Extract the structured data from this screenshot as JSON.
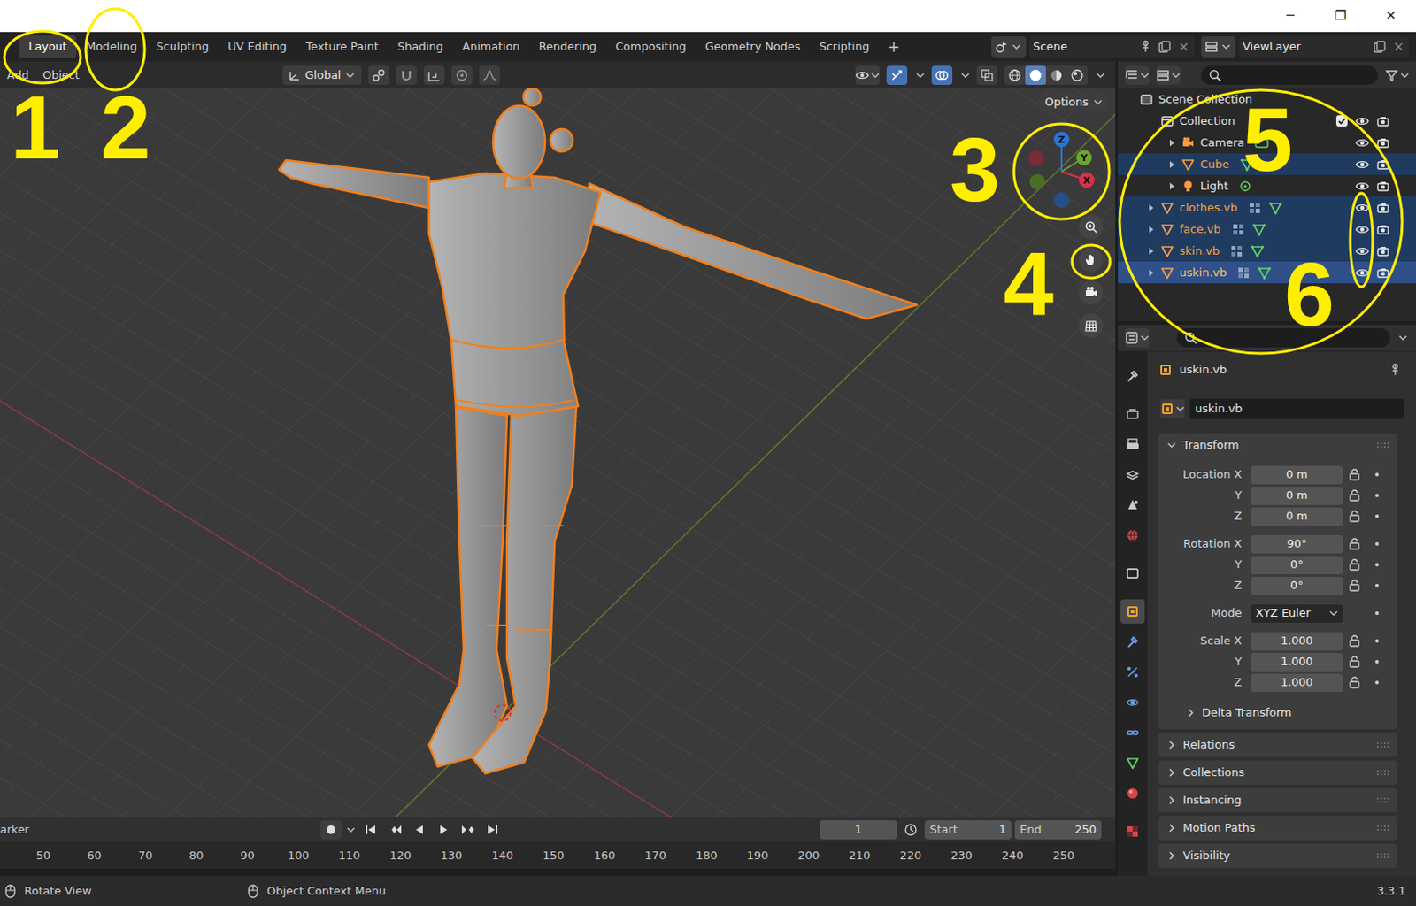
{
  "window": {
    "controls": [
      "─",
      "❐",
      "✕"
    ]
  },
  "workspaces": [
    {
      "label": "Layout",
      "selected": true
    },
    {
      "label": "Modeling",
      "selected": false
    },
    {
      "label": "Sculpting",
      "selected": false
    },
    {
      "label": "UV Editing",
      "selected": false
    },
    {
      "label": "Texture Paint",
      "selected": false
    },
    {
      "label": "Shading",
      "selected": false
    },
    {
      "label": "Animation",
      "selected": false
    },
    {
      "label": "Rendering",
      "selected": false
    },
    {
      "label": "Compositing",
      "selected": false
    },
    {
      "label": "Geometry Nodes",
      "selected": false
    },
    {
      "label": "Scripting",
      "selected": false
    }
  ],
  "add_workspace": "+",
  "scene": {
    "label": "Scene"
  },
  "view_layer": {
    "label": "ViewLayer"
  },
  "viewport": {
    "menus": [
      "Add",
      "Object"
    ],
    "orientation": "Global",
    "options": "Options",
    "gizmo_axes": [
      "X",
      "Y",
      "Z"
    ],
    "toggles": [
      {
        "kind": "gizmo",
        "on": true
      },
      {
        "kind": "overlay",
        "on": true
      },
      {
        "kind": "xray",
        "on": false
      }
    ],
    "shading": [
      {
        "mode": "wireframe",
        "selected": false
      },
      {
        "mode": "solid",
        "selected": true
      },
      {
        "mode": "material",
        "selected": false
      },
      {
        "mode": "rendered",
        "selected": false
      }
    ]
  },
  "annotations": [
    {
      "label": "1"
    },
    {
      "label": "2"
    },
    {
      "label": "3"
    },
    {
      "label": "4"
    },
    {
      "label": "5"
    },
    {
      "label": "6"
    }
  ],
  "outliner": {
    "items": [
      {
        "label": "Scene Collection",
        "kind": "scene",
        "depth": 0,
        "selected": false,
        "active": false
      },
      {
        "label": "Collection",
        "kind": "collection",
        "depth": 1,
        "selected": false,
        "active": false,
        "checked": true,
        "visible": true,
        "renderable": true
      },
      {
        "label": "Camera",
        "kind": "camera",
        "depth": 2,
        "expanded": false,
        "selected": false,
        "active": false,
        "modifiers": false,
        "visible": true,
        "renderable": true
      },
      {
        "label": "Cube",
        "kind": "mesh",
        "depth": 2,
        "expanded": false,
        "selected": true,
        "active": false,
        "modifiers": false,
        "visible": true,
        "renderable": true
      },
      {
        "label": "Light",
        "kind": "light",
        "depth": 2,
        "expanded": false,
        "selected": false,
        "active": false,
        "modifiers": false,
        "visible": true,
        "renderable": true
      },
      {
        "label": "clothes.vb",
        "kind": "mesh",
        "depth": 1,
        "expanded": false,
        "selected": true,
        "active": false,
        "modifiers": true,
        "visible": true,
        "renderable": true
      },
      {
        "label": "face.vb",
        "kind": "mesh",
        "depth": 1,
        "expanded": false,
        "selected": true,
        "active": false,
        "modifiers": true,
        "visible": true,
        "renderable": true
      },
      {
        "label": "skin.vb",
        "kind": "mesh",
        "depth": 1,
        "expanded": false,
        "selected": true,
        "active": false,
        "modifiers": true,
        "visible": true,
        "renderable": true
      },
      {
        "label": "uskin.vb",
        "kind": "mesh",
        "depth": 1,
        "expanded": false,
        "selected": true,
        "active": true,
        "modifiers": true,
        "visible": true,
        "renderable": true
      }
    ]
  },
  "properties": {
    "tabs": [
      {
        "kind": "tool",
        "selected": false
      },
      {
        "kind": "render",
        "selected": false
      },
      {
        "kind": "output",
        "selected": false
      },
      {
        "kind": "view_layer",
        "selected": false
      },
      {
        "kind": "scene",
        "selected": false
      },
      {
        "kind": "world",
        "selected": false
      },
      {
        "kind": "collection",
        "selected": false
      },
      {
        "kind": "object",
        "selected": true
      },
      {
        "kind": "modifiers",
        "selected": false
      },
      {
        "kind": "particles",
        "selected": false
      },
      {
        "kind": "physics",
        "selected": false
      },
      {
        "kind": "constraints",
        "selected": false
      },
      {
        "kind": "data",
        "selected": false
      },
      {
        "kind": "material",
        "selected": false
      },
      {
        "kind": "texture",
        "selected": false
      }
    ],
    "object_name": "uskin.vb",
    "name_field": "uskin.vb",
    "transform": {
      "title": "Transform",
      "expanded": true,
      "groups": [
        [
          {
            "label": "Location X",
            "value": "0 m",
            "kind": "field"
          },
          {
            "label": "Y",
            "value": "0 m",
            "kind": "field"
          },
          {
            "label": "Z",
            "value": "0 m",
            "kind": "field"
          }
        ],
        [
          {
            "label": "Rotation X",
            "value": "90°",
            "kind": "field"
          },
          {
            "label": "Y",
            "value": "0°",
            "kind": "field"
          },
          {
            "label": "Z",
            "value": "0°",
            "kind": "field"
          }
        ],
        [
          {
            "label": "Mode",
            "value": "XYZ Euler",
            "kind": "dropdown"
          }
        ],
        [
          {
            "label": "Scale X",
            "value": "1.000",
            "kind": "field"
          },
          {
            "label": "Y",
            "value": "1.000",
            "kind": "field"
          },
          {
            "label": "Z",
            "value": "1.000",
            "kind": "field"
          }
        ]
      ],
      "sub": {
        "title": "Delta Transform",
        "expanded": false
      }
    },
    "panels": [
      {
        "title": "Relations",
        "expanded": false
      },
      {
        "title": "Collections",
        "expanded": false
      },
      {
        "title": "Instancing",
        "expanded": false
      },
      {
        "title": "Motion Paths",
        "expanded": false
      },
      {
        "title": "Visibility",
        "expanded": false
      }
    ]
  },
  "timeline": {
    "marker": "arker",
    "frame": "1",
    "start_label": "Start",
    "start": "1",
    "end_label": "End",
    "end": "250",
    "ticks": [
      "50",
      "60",
      "70",
      "80",
      "90",
      "100",
      "110",
      "120",
      "130",
      "140",
      "150",
      "160",
      "170",
      "180",
      "190",
      "200",
      "210",
      "220",
      "230",
      "240",
      "250"
    ]
  },
  "status_bar": {
    "hints": [
      "Rotate View",
      "Object Context Menu"
    ],
    "version": "3.3.1"
  }
}
